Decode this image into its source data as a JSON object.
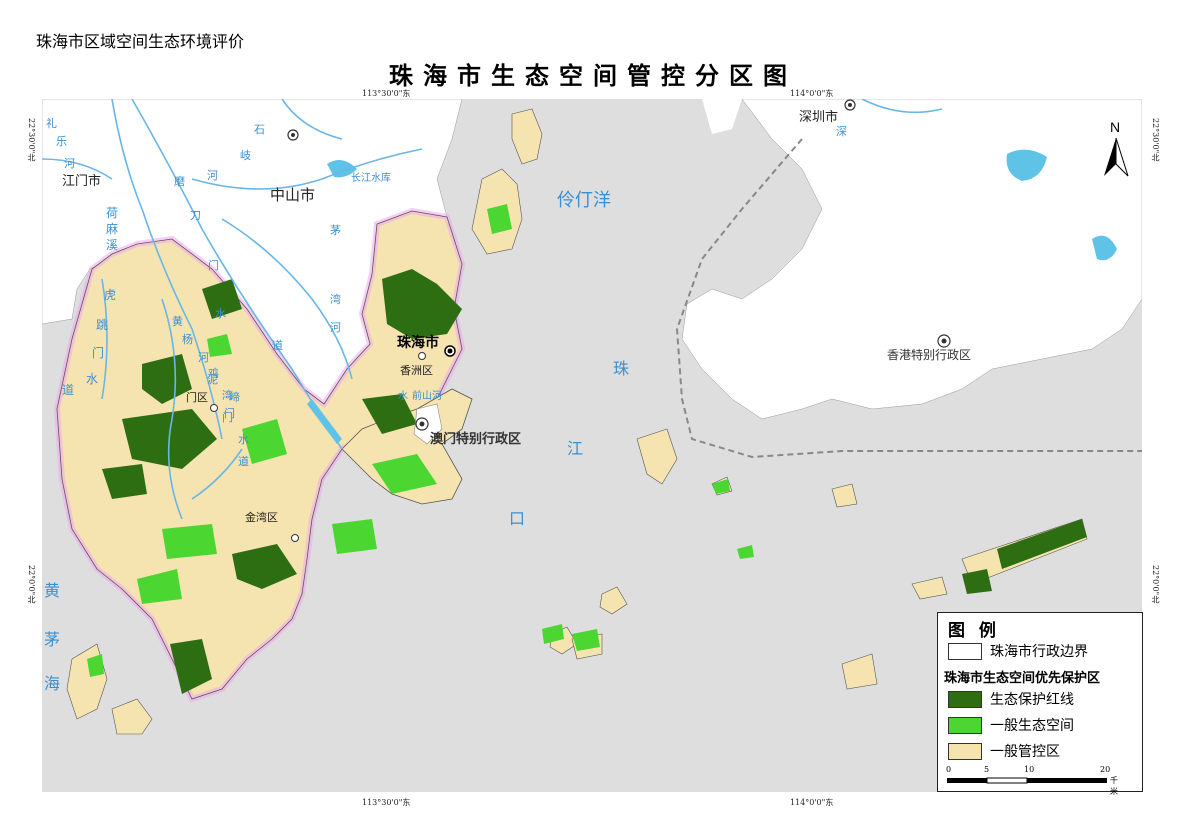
{
  "header": {
    "caption": "珠海市区域空间生态环境评价",
    "title": "珠海市生态空间管控分区图"
  },
  "coordinates": {
    "top_left": "113°30'0\"东",
    "top_right": "114°0'0\"东",
    "bottom_left": "113°30'0\"东",
    "bottom_right": "114°0'0\"东",
    "left_upper": "22°30'0\"北",
    "left_lower": "22°0'0\"北",
    "right_upper": "22°30'0\"北",
    "right_lower": "22°0'0\"北"
  },
  "places": {
    "jiangmen": "江门市",
    "zhongshan": "中山市",
    "shenzhen": "深圳市",
    "shenzhen_river": "深",
    "zhuhai": "珠海市",
    "xiangzhou": "香洲区",
    "doumen": "门区",
    "jinwan": "金湾区",
    "macau": "澳门特别行政区",
    "hongkong": "香港特别行政区",
    "changjiang": "长江水库",
    "lingdingyang": "伶仃洋",
    "zhujiangkou": [
      "珠",
      "江",
      "口"
    ],
    "huangmaohai": [
      "黄",
      "茅",
      "海"
    ],
    "rivers_left": [
      "礼",
      "乐",
      "河"
    ],
    "hu_tiao_men": [
      "虎",
      "跳",
      "门",
      "水",
      "道"
    ],
    "he_ma_xi": [
      "荷",
      "麻",
      "溪"
    ],
    "shi_qi_he": [
      "石",
      "岐",
      "河"
    ],
    "mo_dao_men": [
      "磨",
      "刀",
      "门",
      "水",
      "道"
    ],
    "mao_wan_he": [
      "茅",
      "湾",
      "河"
    ],
    "yin_he": [
      "黄",
      "杨",
      "河"
    ],
    "ni_wan_men": [
      "泥",
      "湾",
      "门"
    ],
    "ji_men": [
      "鸡",
      "啼",
      "门",
      "水",
      "道"
    ],
    "qian_shan_he": "前山河",
    "shui": "水"
  },
  "legend": {
    "title": "图 例",
    "boundary": "珠海市行政边界",
    "subtitle": "珠海市生态空间优先保护区",
    "items": [
      {
        "label": "生态保护红线",
        "color": "#2d6e12"
      },
      {
        "label": "一般生态空间",
        "color": "#4cd631"
      },
      {
        "label": "一般管控区",
        "color": "#f5e4b0"
      }
    ],
    "scale_ticks": [
      "0",
      "5",
      "10",
      "20"
    ],
    "scale_unit": "千米"
  },
  "north_label": "N",
  "colors": {
    "sea": "#dedede",
    "land_other": "#ffffff",
    "zhuhai_land": "#f5e4b0",
    "red_line": "#2d6e12",
    "general_eco": "#4cd631",
    "water": "#5fc3e8",
    "boundary_glow": "#f0a6f0"
  }
}
